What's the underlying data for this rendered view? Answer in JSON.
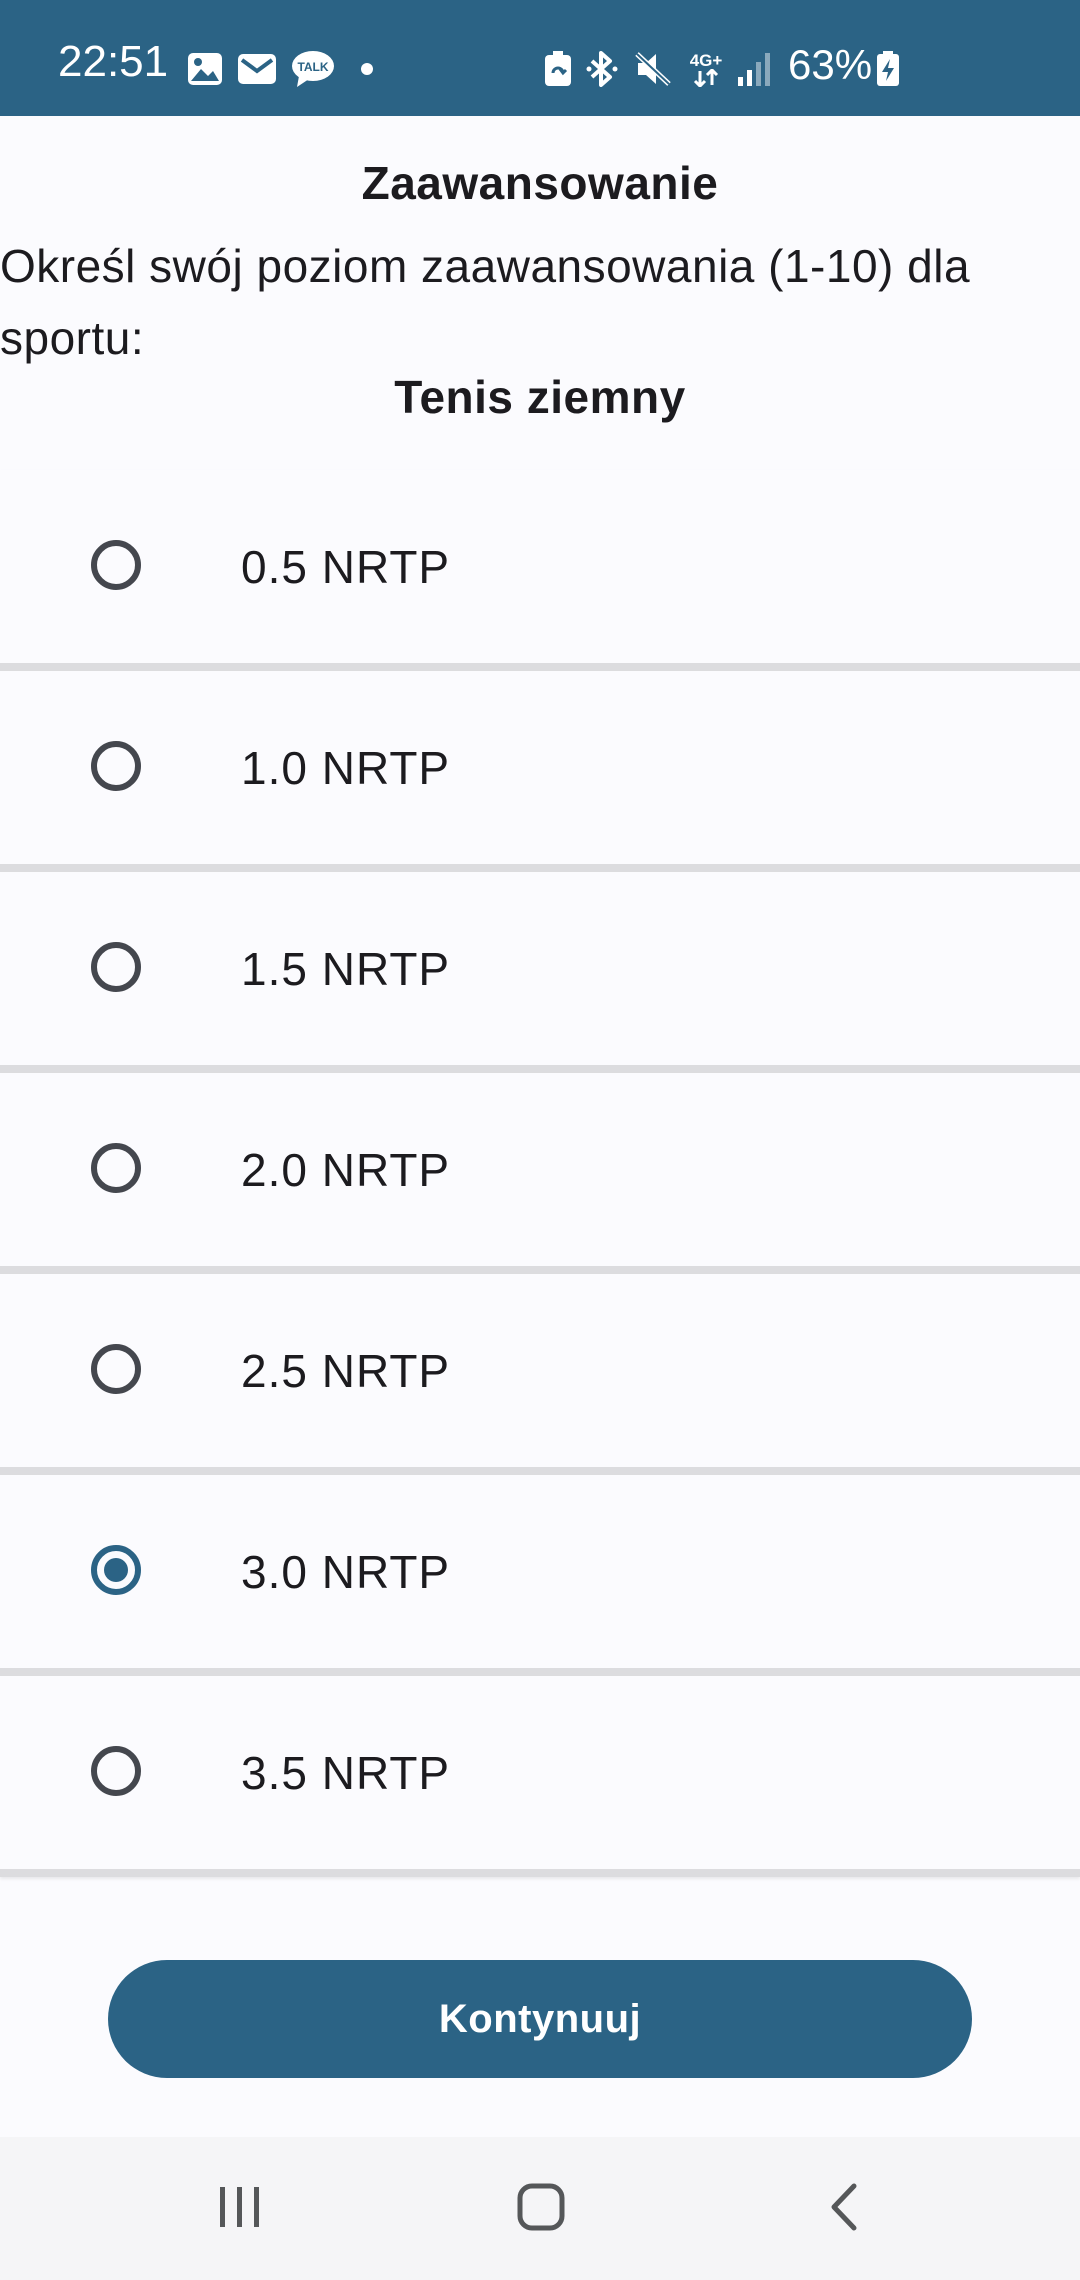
{
  "status_bar": {
    "time": "22:51",
    "battery_percent": "63%",
    "network_label": "4G+",
    "notification_icons": [
      "image-icon",
      "mail-icon",
      "talk-icon",
      "dot-icon"
    ],
    "system_icons": [
      "battery-saver-icon",
      "bluetooth-icon",
      "mute-icon",
      "network-4g-icon",
      "signal-icon",
      "battery-icon"
    ],
    "color": "#2b6385"
  },
  "header": {
    "title": "Zaawansowanie",
    "instruction": "Określ swój poziom zaawansowania (1-10) dla sportu:",
    "sport": "Tenis ziemny"
  },
  "options": [
    {
      "label": "0.5 NRTP",
      "selected": false
    },
    {
      "label": "1.0 NRTP",
      "selected": false
    },
    {
      "label": "1.5 NRTP",
      "selected": false
    },
    {
      "label": "2.0 NRTP",
      "selected": false
    },
    {
      "label": "2.5 NRTP",
      "selected": false
    },
    {
      "label": "3.0 NRTP",
      "selected": true
    },
    {
      "label": "3.5 NRTP",
      "selected": false
    }
  ],
  "continue_button": {
    "label": "Kontynuuj",
    "color": "#2b6385"
  },
  "nav_bar": {
    "icons": [
      "recent-apps-icon",
      "home-icon",
      "back-icon"
    ]
  }
}
